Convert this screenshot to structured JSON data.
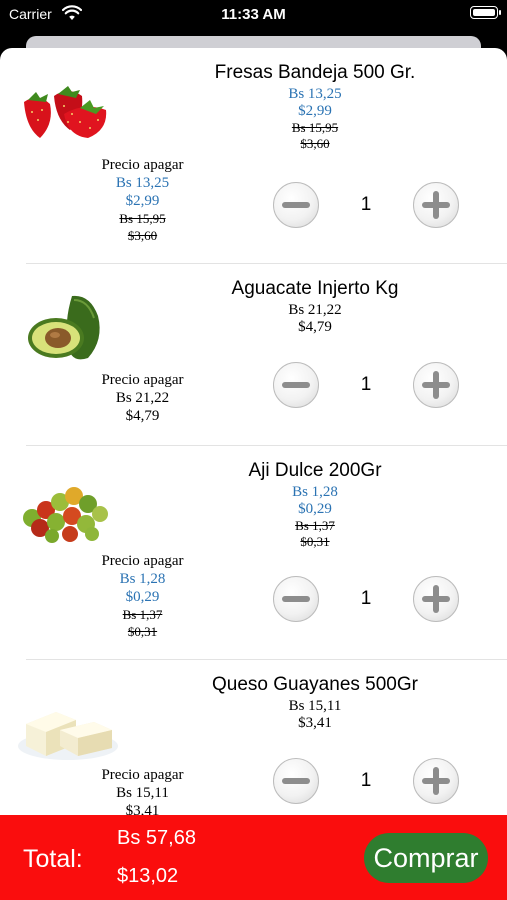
{
  "status_bar": {
    "carrier": "Carrier",
    "time": "11:33 AM"
  },
  "products": [
    {
      "name": "Fresas Bandeja 500 Gr.",
      "image": "strawberries",
      "on_sale": true,
      "price_bs": "Bs 13,25",
      "price_usd": "$2,99",
      "old_bs": "Bs 15,95",
      "old_usd": "$3,60",
      "pay_label": "Precio apagar",
      "pay_bs": "Bs 13,25",
      "pay_usd": "$2,99",
      "pay_old_bs": "Bs 15,95",
      "pay_old_usd": "$3,60",
      "quantity": "1"
    },
    {
      "name": "Aguacate Injerto Kg",
      "image": "avocado",
      "on_sale": false,
      "price_bs": "Bs 21,22",
      "price_usd": "$4,79",
      "pay_label": "Precio apagar",
      "pay_bs": "Bs 21,22",
      "pay_usd": "$4,79",
      "quantity": "1"
    },
    {
      "name": "Aji Dulce 200Gr",
      "image": "sweet-peppers",
      "on_sale": true,
      "price_bs": "Bs 1,28",
      "price_usd": "$0,29",
      "old_bs": "Bs 1,37",
      "old_usd": "$0,31",
      "pay_label": "Precio apagar",
      "pay_bs": "Bs 1,28",
      "pay_usd": "$0,29",
      "pay_old_bs": "Bs 1,37",
      "pay_old_usd": "$0,31",
      "quantity": "1"
    },
    {
      "name": "Queso Guayanes 500Gr",
      "image": "cheese",
      "on_sale": false,
      "price_bs": "Bs 15,11",
      "price_usd": "$3,41",
      "pay_label": "Precio apagar",
      "pay_bs": "Bs 15,11",
      "pay_usd": "$3,41",
      "quantity": "1"
    }
  ],
  "footer": {
    "total_label": "Total:",
    "total_bs": "Bs 57,68",
    "total_usd": "$13,02",
    "buy_label": "Comprar"
  },
  "colors": {
    "sale_price": "#2b73b3",
    "footer_bg": "#fa0d0d",
    "buy_button": "#2f7d2f"
  },
  "icons": {
    "minus": "minus-icon",
    "plus": "plus-icon",
    "wifi": "wifi-icon",
    "battery": "battery-icon"
  }
}
